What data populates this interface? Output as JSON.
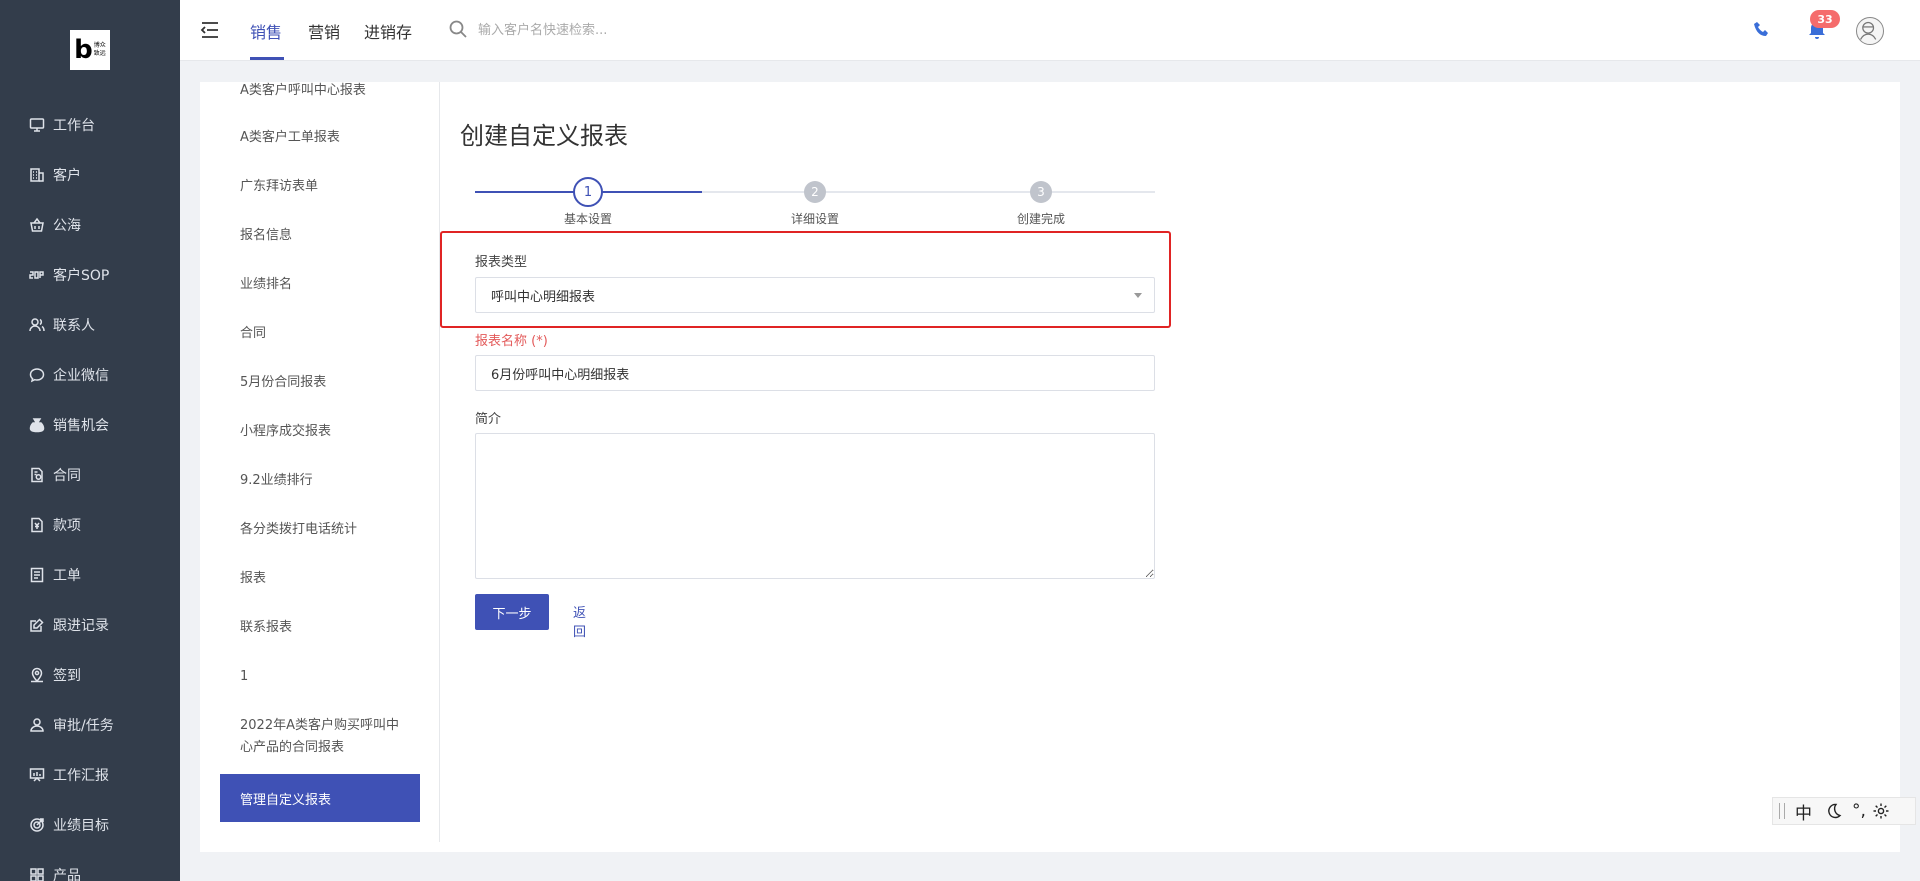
{
  "logo": {
    "letter": "b",
    "line1": "博众",
    "line2": "致远"
  },
  "sidebar": {
    "items": [
      {
        "label": "工作台",
        "icon": "monitor-icon"
      },
      {
        "label": "客户",
        "icon": "building-icon"
      },
      {
        "label": "公海",
        "icon": "basket-icon"
      },
      {
        "label": "客户SOP",
        "icon": "sop-icon"
      },
      {
        "label": "联系人",
        "icon": "contacts-icon"
      },
      {
        "label": "企业微信",
        "icon": "wechat-icon"
      },
      {
        "label": "销售机会",
        "icon": "moneybag-icon"
      },
      {
        "label": "合同",
        "icon": "contract-icon"
      },
      {
        "label": "款项",
        "icon": "payment-icon"
      },
      {
        "label": "工单",
        "icon": "ticket-icon"
      },
      {
        "label": "跟进记录",
        "icon": "edit-icon"
      },
      {
        "label": "签到",
        "icon": "location-icon"
      },
      {
        "label": "审批/任务",
        "icon": "approval-icon"
      },
      {
        "label": "工作汇报",
        "icon": "report-icon"
      },
      {
        "label": "业绩目标",
        "icon": "target-icon"
      },
      {
        "label": "产品",
        "icon": "product-icon"
      }
    ]
  },
  "topbar": {
    "tabs": [
      "销售",
      "营销",
      "进销存"
    ],
    "active_tab": 0,
    "search_placeholder": "输入客户名快速检索...",
    "notification_count": "33"
  },
  "report_list": {
    "items": [
      "A类客户呼叫中心报表",
      "A类客户工单报表",
      "广东拜访表单",
      "报名信息",
      "业绩排名",
      "合同",
      "5月份合同报表",
      "小程序成交报表",
      "9.2业绩排行",
      "各分类拨打电话统计",
      "报表",
      "联系报表",
      "1",
      "2022年A类客户购买呼叫中心产品的合同报表"
    ],
    "active_item": "管理自定义报表"
  },
  "form": {
    "title": "创建自定义报表",
    "steps": [
      {
        "number": "1",
        "label": "基本设置"
      },
      {
        "number": "2",
        "label": "详细设置"
      },
      {
        "number": "3",
        "label": "创建完成"
      }
    ],
    "report_type_label": "报表类型",
    "report_type_value": "呼叫中心明细报表",
    "report_name_label": "报表名称 (*)",
    "report_name_value": "6月份呼叫中心明细报表",
    "description_label": "简介",
    "description_value": "",
    "next_button": "下一步",
    "back_link": "返回"
  },
  "ime": {
    "mode": "中",
    "punct": "°,"
  },
  "colors": {
    "sidebar_bg": "#333d4b",
    "accent": "#3f51b5",
    "highlight_border": "#e02424",
    "required": "#e35a5a",
    "badge": "#f56c6c"
  }
}
